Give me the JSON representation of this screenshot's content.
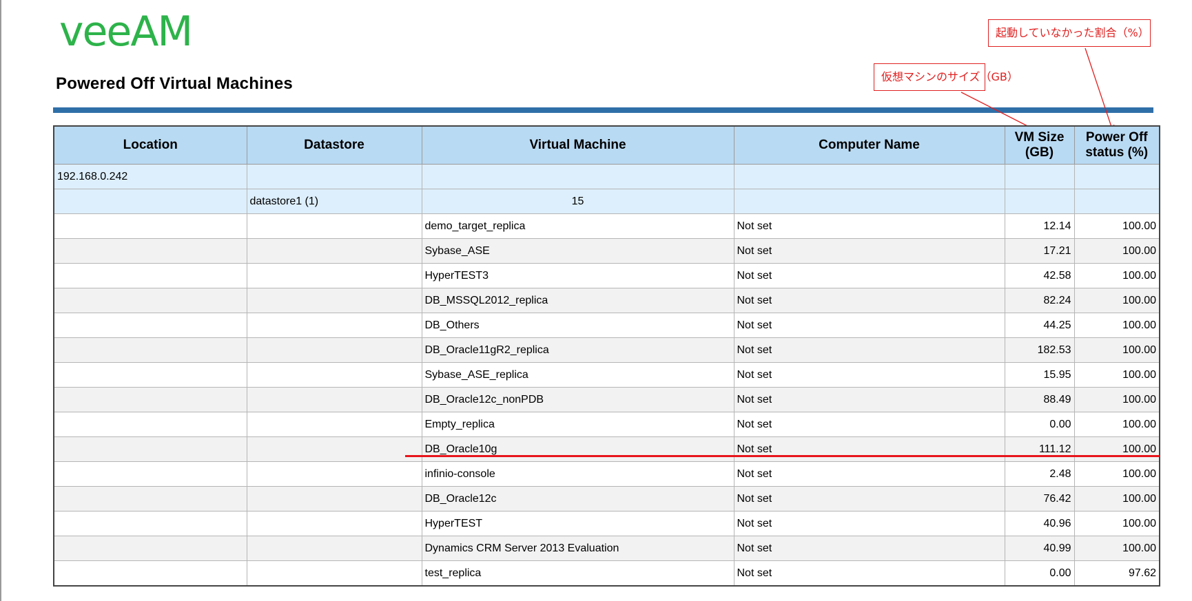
{
  "brand": {
    "logo_text": "veeAM",
    "logo_color": "#2db34a"
  },
  "page_title": "Powered Off Virtual Machines",
  "annotations": {
    "vm_size_note": "仮想マシンのサイズ（GB）",
    "power_off_note": "起動していなかった割合（%）",
    "color": "#e02020"
  },
  "table": {
    "headers": {
      "location": "Location",
      "datastore": "Datastore",
      "virtual_machine": "Virtual Machine",
      "computer_name": "Computer Name",
      "vm_size": "VM Size (GB)",
      "power_off": "Power Off status (%)"
    },
    "host_row": {
      "location": "192.168.0.242"
    },
    "datastore_row": {
      "datastore": "datastore1 (1)",
      "vm_count": "15"
    },
    "rows": [
      {
        "vm": "demo_target_replica",
        "computer": "Not set",
        "size": "12.14",
        "status": "100.00"
      },
      {
        "vm": "Sybase_ASE",
        "computer": "Not set",
        "size": "17.21",
        "status": "100.00"
      },
      {
        "vm": "HyperTEST3",
        "computer": "Not set",
        "size": "42.58",
        "status": "100.00"
      },
      {
        "vm": "DB_MSSQL2012_replica",
        "computer": "Not set",
        "size": "82.24",
        "status": "100.00"
      },
      {
        "vm": "DB_Others",
        "computer": "Not set",
        "size": "44.25",
        "status": "100.00"
      },
      {
        "vm": "DB_Oracle11gR2_replica",
        "computer": "Not set",
        "size": "182.53",
        "status": "100.00"
      },
      {
        "vm": "Sybase_ASE_replica",
        "computer": "Not set",
        "size": "15.95",
        "status": "100.00"
      },
      {
        "vm": "DB_Oracle12c_nonPDB",
        "computer": "Not set",
        "size": "88.49",
        "status": "100.00"
      },
      {
        "vm": "Empty_replica",
        "computer": "Not set",
        "size": "0.00",
        "status": "100.00"
      },
      {
        "vm": "DB_Oracle10g",
        "computer": "Not set",
        "size": "111.12",
        "status": "100.00"
      },
      {
        "vm": "infinio-console",
        "computer": "Not set",
        "size": "2.48",
        "status": "100.00"
      },
      {
        "vm": "DB_Oracle12c",
        "computer": "Not set",
        "size": "76.42",
        "status": "100.00"
      },
      {
        "vm": "HyperTEST",
        "computer": "Not set",
        "size": "40.96",
        "status": "100.00"
      },
      {
        "vm": "Dynamics CRM Server 2013 Evaluation",
        "computer": "Not set",
        "size": "40.99",
        "status": "100.00"
      },
      {
        "vm": "test_replica",
        "computer": "Not set",
        "size": "0.00",
        "status": "97.62"
      }
    ]
  },
  "colors": {
    "header_bg": "#b9daf3",
    "group_bg": "#ddeffc",
    "rule": "#2f6fa8",
    "highlight_line": "#e8141c"
  }
}
